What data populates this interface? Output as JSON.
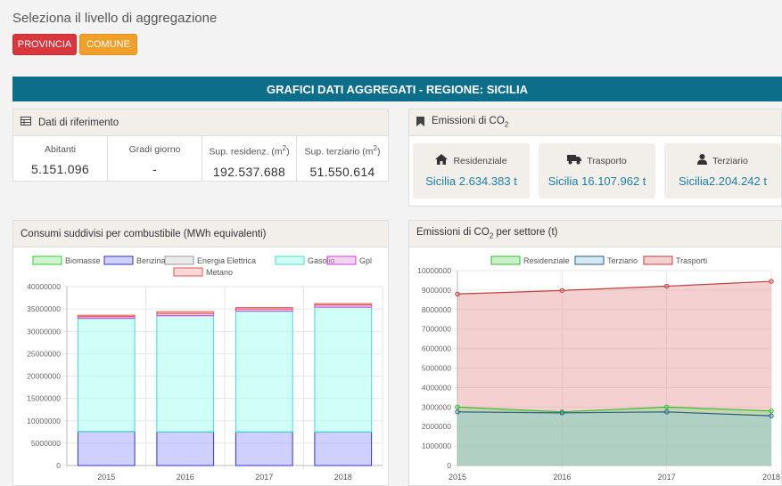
{
  "header": {
    "aggregation_title": "Seleziona il livello di aggregazione"
  },
  "buttons": {
    "provincia": "PROVINCIA",
    "comune": "COMUNE"
  },
  "banner": {
    "title": "GRAFICI DATI AGGREGATI - REGIONE: SICILIA"
  },
  "ref_panel": {
    "title": "Dati di riferimento",
    "columns": [
      {
        "label": "Abitanti",
        "value": "5.151.096"
      },
      {
        "label": "Gradi giorno",
        "value": "-"
      },
      {
        "label_pre": "Sup. residenz. (m",
        "label_sup": "2",
        "label_post": ")",
        "value": "192.537.688"
      },
      {
        "label_pre": "Sup. terziario (m",
        "label_sup": "2",
        "label_post": ")",
        "value": "51.550.614"
      }
    ]
  },
  "emissions_panel": {
    "title_pre": "Emissioni di CO",
    "title_sub": "2",
    "cards": [
      {
        "icon": "home-icon",
        "label": "Residenziale",
        "value": "Sicilia 2.634.383 t"
      },
      {
        "icon": "truck-icon",
        "label": "Trasporto",
        "value": "Sicilia 16.107.962 t"
      },
      {
        "icon": "user-icon",
        "label": "Terziario",
        "value": "Sicilia2.204.242 t"
      }
    ]
  },
  "fuel_panel": {
    "title": "Consumi suddivisi per combustibile (MWh equivalenti)"
  },
  "sector_panel": {
    "title_pre": "Emissioni di CO",
    "title_sub": "2",
    "title_post": " per settore (t)"
  },
  "colors": {
    "accent_banner": "#0d6e8a",
    "btn_provincia": "#d9363e",
    "btn_comune": "#f0a02a",
    "value_blue": "#1f7ea0"
  },
  "chart_data": [
    {
      "type": "bar",
      "stacked": true,
      "categories": [
        "2015",
        "2016",
        "2017",
        "2018"
      ],
      "ylim": [
        0,
        40000000
      ],
      "yticks": [
        "0",
        "5000000",
        "10000000",
        "15000000",
        "20000000",
        "25000000",
        "30000000",
        "35000000",
        "40000000"
      ],
      "legend_position": "top",
      "series": [
        {
          "name": "Biomasse",
          "fill": "rgba(120,220,120,0.35)",
          "stroke": "#33cc33",
          "values": [
            0,
            0,
            0,
            0
          ]
        },
        {
          "name": "Benzina",
          "fill": "rgba(150,150,255,0.45)",
          "stroke": "#3333cc",
          "values": [
            7600000,
            7500000,
            7500000,
            7500000
          ]
        },
        {
          "name": "Energia Elettrica",
          "fill": "rgba(220,220,220,0.6)",
          "stroke": "#999999",
          "values": [
            0,
            0,
            0,
            0
          ]
        },
        {
          "name": "Gasolio",
          "fill": "rgba(160,255,240,0.5)",
          "stroke": "#40e0c8",
          "values": [
            25300000,
            26000000,
            27000000,
            27900000
          ]
        },
        {
          "name": "Gpl",
          "fill": "rgba(230,170,230,0.5)",
          "stroke": "#cc44cc",
          "values": [
            400000,
            500000,
            500000,
            500000
          ]
        },
        {
          "name": "Metano",
          "fill": "rgba(255,180,180,0.5)",
          "stroke": "#e05555",
          "values": [
            300000,
            400000,
            300000,
            300000
          ]
        }
      ]
    },
    {
      "type": "area",
      "x": [
        "2015",
        "2016",
        "2017",
        "2018"
      ],
      "ylim": [
        0,
        10000000
      ],
      "yticks": [
        "0",
        "1000000",
        "2000000",
        "3000000",
        "4000000",
        "5000000",
        "6000000",
        "7000000",
        "8000000",
        "9000000",
        "10000000"
      ],
      "legend_position": "top",
      "series": [
        {
          "name": "Residenziale",
          "fill": "rgba(120,220,120,0.4)",
          "stroke": "#33bb33",
          "values": [
            3000000,
            2750000,
            3000000,
            2800000
          ]
        },
        {
          "name": "Terziario",
          "fill": "rgba(150,200,230,0.4)",
          "stroke": "#2a5f80",
          "values": [
            2750000,
            2700000,
            2750000,
            2550000
          ]
        },
        {
          "name": "Trasporti",
          "fill": "rgba(230,150,150,0.45)",
          "stroke": "#c04040",
          "values": [
            8800000,
            8980000,
            9200000,
            9450000
          ]
        }
      ]
    }
  ]
}
